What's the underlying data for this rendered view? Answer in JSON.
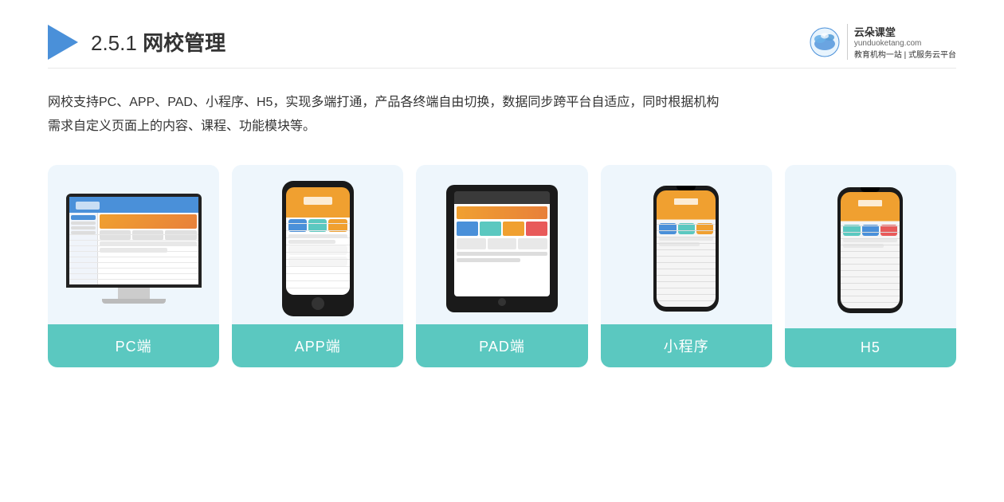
{
  "header": {
    "title_prefix": "2.5.1 ",
    "title_main": "网校管理",
    "brand": {
      "name": "云朵课堂",
      "url": "yunduoketang.com",
      "slogan_line1": "教育机构一站",
      "slogan_line2": "式服务云平台"
    }
  },
  "description": {
    "line1": "网校支持PC、APP、PAD、小程序、H5，实现多端打通，产品各终端自由切换，数据同步跨平台自适应，同时根据机构",
    "line2": "需求自定义页面上的内容、课程、功能模块等。"
  },
  "cards": [
    {
      "id": "pc",
      "label": "PC端"
    },
    {
      "id": "app",
      "label": "APP端"
    },
    {
      "id": "pad",
      "label": "PAD端"
    },
    {
      "id": "miniprogram",
      "label": "小程序"
    },
    {
      "id": "h5",
      "label": "H5"
    }
  ]
}
